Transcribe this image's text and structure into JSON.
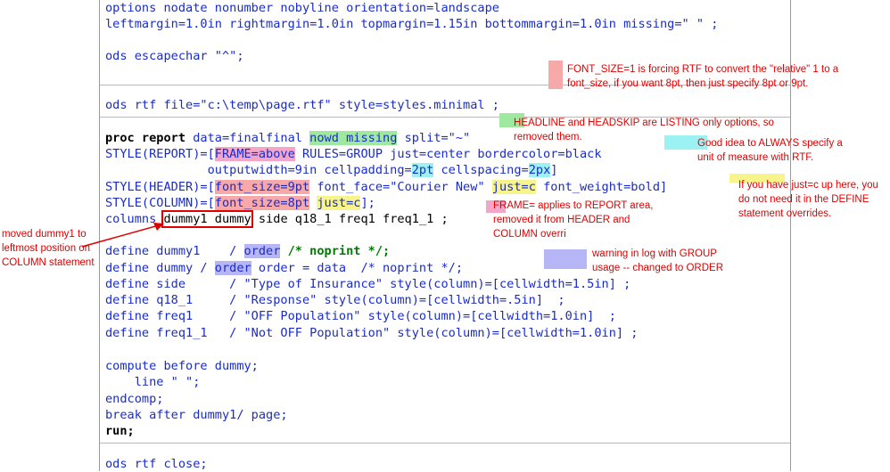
{
  "editor": {
    "line1": "options nodate nonumber nobyline orientation=landscape",
    "line2": "leftmargin=1.0in rightmargin=1.0in topmargin=1.15in bottommargin=1.0in missing=\" \" ;",
    "line3": "ods escapechar \"^\";",
    "line4": "ods rtf file=\"c:\\temp\\page.rtf\" style=styles.minimal ;",
    "proc_report": {
      "kw1": "proc report",
      "data": "data=finalfinal",
      "nowd": "nowd missing",
      "split": "split=\"~\"",
      "style_report_kw": "STYLE(REPORT)=[",
      "frame": "FRAME=above",
      "rules": " RULES=GROUP just=center bordercolor=black",
      "cont_pre": "              outputwidth=9in cellpadding=",
      "cellpadding": "2pt",
      "cellspacing_kw": " cellspacing=",
      "cellspacing": "2px",
      "cont_end": "]",
      "style_header_kw": "STYLE(HEADER)=[",
      "fs9": "font_size=9pt",
      "font_face": " font_face=\"Courier New\" ",
      "justc1": "just=c",
      "fw": " font_weight=bold]",
      "style_column_kw": "STYLE(COLUMN)=[",
      "fs8": "font_size=8pt",
      "justc2": "just=c",
      "col_end": "];",
      "columns_kw": "columns ",
      "columns_boxed": "dummy1 dummy",
      "columns_rest": " side q18_1 freq1 freq1_1 ;"
    },
    "defines": [
      {
        "pre": "define dummy1    / ",
        "hl": "order",
        "post": " /* noprint */;"
      },
      {
        "pre": "define dummy / ",
        "hl": "order",
        "post": " order = data  /* noprint */;"
      },
      {
        "pre": "define side      / \"Type of Insurance\" style(column)=[cellwidth=1.5in] ;"
      },
      {
        "pre": "define q18_1     / \"Response\" style(column)=[cellwidth=.5in]  ;"
      },
      {
        "pre": "define freq1     / \"OFF Population\" style(column)=[cellwidth=1.0in]  ;"
      },
      {
        "pre": "define freq1_1   / \"Not OFF Population\" style(column)=[cellwidth=1.0in] ;"
      }
    ],
    "compute1": "compute before dummy;",
    "compute2": "    line \" \";",
    "compute3": "endcomp;",
    "break": "break after dummy1/ page;",
    "run": "run;",
    "close": "ods rtf close;"
  },
  "annotations": {
    "font_size": "FONT_SIZE=1 is forcing RTF to convert the \"relative\" 1 to a font_size, if you want 8pt, then just specify 8pt or 9pt.",
    "headline": "HEADLINE and HEADSKIP are LISTING only options, so removed them.",
    "unit": "Good idea to ALWAYS specify a unit of measure with RTF.",
    "justc": "If you have just=c up here, you do not need it in the DEFINE statement overrides.",
    "frame": "FRAME= applies to REPORT area, removed it from HEADER and COLUMN overri",
    "group": "warning in log with GROUP usage -- changed to ORDER",
    "moved": "moved dummy1 to leftmost position on COLUMN statement"
  },
  "colors": {
    "keyword": "#1a2cc8",
    "string": "#7a1fa0",
    "number": "#0a7f7f",
    "comment": "#007a00",
    "annotation": "#e00000"
  }
}
